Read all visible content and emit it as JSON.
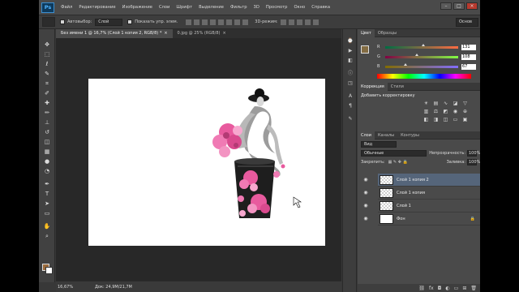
{
  "menu": {
    "logo": "Ps",
    "items": [
      "Файл",
      "Редактирование",
      "Изображение",
      "Слои",
      "Шрифт",
      "Выделение",
      "Фильтр",
      "3D",
      "Просмотр",
      "Окно",
      "Справка"
    ]
  },
  "window_controls": [
    "–",
    "□",
    "×"
  ],
  "options": {
    "autoselect_label": "Автовыбор:",
    "autoselect_value": "Слой",
    "show_controls_label": "Показать упр. элем.",
    "mode_3d": "3D-режим:",
    "workspace": "Основ"
  },
  "tabs": [
    {
      "label": "Без имени 1 @ 16,7% (Слой 1 копия 2, RGB/8) *",
      "close": "×"
    },
    {
      "label": "0.jpg @ 25% (RGB/8)",
      "close": "×"
    }
  ],
  "status": {
    "zoom": "16,67%",
    "doc": "Док: 24,9M/21,7M"
  },
  "color_panel": {
    "tabs": [
      "Цвет",
      "Образцы"
    ],
    "channels": [
      {
        "label": "R",
        "value": "131",
        "pos": 0.51
      },
      {
        "label": "G",
        "value": "108",
        "pos": 0.42
      },
      {
        "label": "B",
        "value": "67",
        "pos": 0.26
      }
    ],
    "fg_color": "#836c43"
  },
  "adjustments": {
    "tabs": [
      "Коррекция",
      "Стили"
    ],
    "title": "Добавить корректировку"
  },
  "layers": {
    "tabs": [
      "Слои",
      "Каналы",
      "Контуры"
    ],
    "filter": "Вид",
    "blend_mode": "Обычные",
    "opacity_label": "Непрозрачность:",
    "opacity": "100%",
    "lock_label": "Закрепить:",
    "fill_label": "Заливка:",
    "fill": "100%",
    "items": [
      {
        "name": "Слой 1 копия 2"
      },
      {
        "name": "Слой 1 копия"
      },
      {
        "name": "Слой 1"
      },
      {
        "name": "Фон"
      }
    ]
  }
}
